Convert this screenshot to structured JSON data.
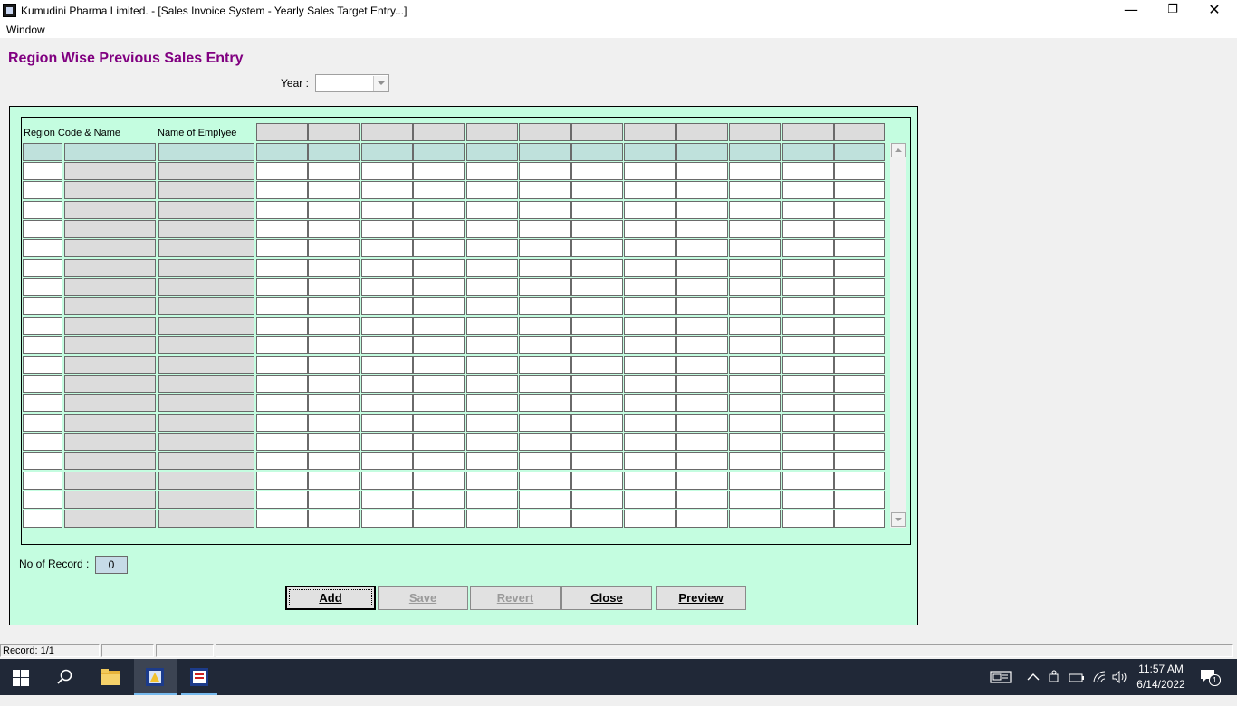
{
  "window": {
    "title": "Kumudini Pharma Limited. - [Sales Invoice System - Yearly Sales Target Entry...]",
    "minimize_glyph": "—",
    "restore_glyph": "❐",
    "close_glyph": "✕"
  },
  "menu": {
    "window": "Window"
  },
  "form": {
    "title": "Region Wise Previous Sales Entry",
    "year_label": "Year :",
    "year_value": ""
  },
  "grid": {
    "headers": {
      "region": "Region Code & Name",
      "employee": "Name of Emplyee"
    },
    "data_rows": 19,
    "month_columns": 12
  },
  "records": {
    "label": "No of Record :",
    "value": "0"
  },
  "buttons": {
    "add": "Add",
    "save": "Save",
    "revert": "Revert",
    "close": "Close",
    "preview": "Preview"
  },
  "status": {
    "record": "Record: 1/1"
  },
  "taskbar": {
    "time": "11:57 AM",
    "date": "6/14/2022",
    "notification_count": "1",
    "icons": [
      "windows-start-icon",
      "search-icon",
      "file-explorer-icon",
      "app-icon-1",
      "app-icon-2"
    ]
  },
  "colors": {
    "title": "#800080",
    "panel_bg": "#c4fde0",
    "grid_header_cell": "#bfe1dc",
    "readonly_cell": "#dcdcdc",
    "taskbar_bg": "#202837"
  }
}
